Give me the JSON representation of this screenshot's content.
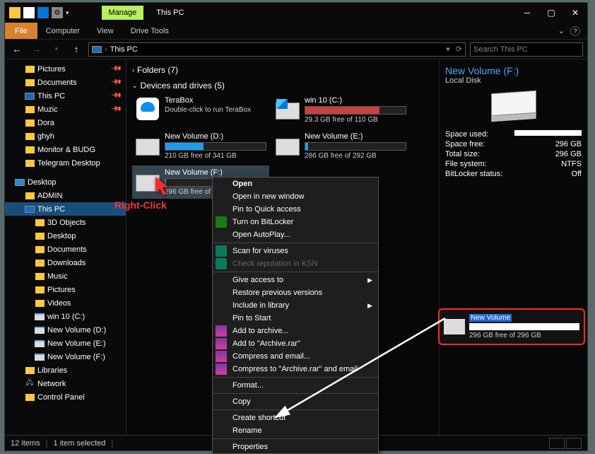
{
  "title": "This PC",
  "tabs": {
    "manage": "Manage"
  },
  "menu": {
    "file": "File",
    "computer": "Computer",
    "view": "View",
    "drive_tools": "Drive Tools"
  },
  "address": {
    "location": "This PC",
    "refresh_glyph": "⟳",
    "dropdown_glyph": "▾"
  },
  "search": {
    "placeholder": "Search This PC"
  },
  "sidebar": {
    "quick": [
      {
        "label": "Pictures",
        "pin": true,
        "icon": "folder"
      },
      {
        "label": "Documents",
        "pin": true,
        "icon": "folder"
      },
      {
        "label": "This PC",
        "pin": true,
        "icon": "pc"
      },
      {
        "label": "Muzic",
        "pin": true,
        "icon": "folder"
      },
      {
        "label": "Dora",
        "pin": false,
        "icon": "folder"
      },
      {
        "label": "ghyh",
        "pin": false,
        "icon": "folder"
      },
      {
        "label": "Monitor & BUDG",
        "pin": false,
        "icon": "folder"
      },
      {
        "label": "Telegram Desktop",
        "pin": false,
        "icon": "folder"
      }
    ],
    "desktop": "Desktop",
    "desktop_children": [
      {
        "label": "ADMIN",
        "icon": "folder"
      },
      {
        "label": "This PC",
        "icon": "pc",
        "selected": true
      },
      {
        "label": "3D Objects",
        "icon": "folder",
        "indent": true
      },
      {
        "label": "Desktop",
        "icon": "folder",
        "indent": true
      },
      {
        "label": "Documents",
        "icon": "folder",
        "indent": true
      },
      {
        "label": "Downloads",
        "icon": "folder",
        "indent": true
      },
      {
        "label": "Music",
        "icon": "folder",
        "indent": true
      },
      {
        "label": "Pictures",
        "icon": "folder",
        "indent": true
      },
      {
        "label": "Videos",
        "icon": "folder",
        "indent": true
      },
      {
        "label": "win 10 (C:)",
        "icon": "drive",
        "indent": true
      },
      {
        "label": "New Volume (D:)",
        "icon": "drive",
        "indent": true
      },
      {
        "label": "New Volume (E:)",
        "icon": "drive",
        "indent": true
      },
      {
        "label": "New Volume (F:)",
        "icon": "drive",
        "indent": true
      },
      {
        "label": "Libraries",
        "icon": "folder"
      },
      {
        "label": "Network",
        "icon": "net"
      },
      {
        "label": "Control Panel",
        "icon": "folder"
      }
    ]
  },
  "sections": {
    "folders": "Folders (7)",
    "drives": "Devices and drives (5)"
  },
  "drives": [
    {
      "name": "TeraBox",
      "desc": "Double-click to run TeraBox",
      "icon": "terabox",
      "bar": null
    },
    {
      "name": "win 10 (C:)",
      "free": "29.3 GB free of 110 GB",
      "icon": "windisk",
      "fill": 74,
      "red": true
    },
    {
      "name": "New Volume (D:)",
      "free": "210 GB free of 341 GB",
      "icon": "disk",
      "fill": 38
    },
    {
      "name": "New Volume (E:)",
      "free": "286 GB free of 292 GB",
      "icon": "disk",
      "fill": 3
    },
    {
      "name": "New Volume (F:)",
      "free": "296 GB free of 296 GB",
      "icon": "disk",
      "fill": 1,
      "selected": true
    }
  ],
  "details": {
    "title": "New Volume (F:)",
    "subtitle": "Local Disk",
    "rows": [
      {
        "k": "Space used:",
        "v": "",
        "bar": true
      },
      {
        "k": "Space free:",
        "v": "296 GB"
      },
      {
        "k": "Total size:",
        "v": "296 GB"
      },
      {
        "k": "File system:",
        "v": "NTFS"
      },
      {
        "k": "BitLocker status:",
        "v": "Off"
      }
    ]
  },
  "status": {
    "items": "12 items",
    "selected": "1 item selected"
  },
  "ctx": {
    "items": [
      {
        "label": "Open",
        "bold": true
      },
      {
        "label": "Open in new window"
      },
      {
        "label": "Pin to Quick access"
      },
      {
        "label": "Turn on BitLocker",
        "icon": "bitlocker"
      },
      {
        "label": "Open AutoPlay..."
      },
      {
        "sep": true
      },
      {
        "label": "Scan for viruses",
        "icon": "kasp"
      },
      {
        "label": "Check reputation in KSN",
        "icon": "kasp",
        "disabled": true
      },
      {
        "sep": true
      },
      {
        "label": "Give access to",
        "sub": true
      },
      {
        "label": "Restore previous versions"
      },
      {
        "label": "Include in library",
        "sub": true
      },
      {
        "label": "Pin to Start"
      },
      {
        "label": "Add to archive...",
        "icon": "rar"
      },
      {
        "label": "Add to \"Archive.rar\"",
        "icon": "rar"
      },
      {
        "label": "Compress and email...",
        "icon": "rar"
      },
      {
        "label": "Compress to \"Archive.rar\" and email",
        "icon": "rar"
      },
      {
        "sep": true
      },
      {
        "label": "Format..."
      },
      {
        "sep": true
      },
      {
        "label": "Copy"
      },
      {
        "sep": true
      },
      {
        "label": "Create shortcut"
      },
      {
        "label": "Rename"
      },
      {
        "sep": true
      },
      {
        "label": "Properties"
      }
    ]
  },
  "annotation": {
    "label": "Right-Click",
    "callout_name": "New Volume",
    "callout_free": "296 GB free of 296 GB"
  }
}
